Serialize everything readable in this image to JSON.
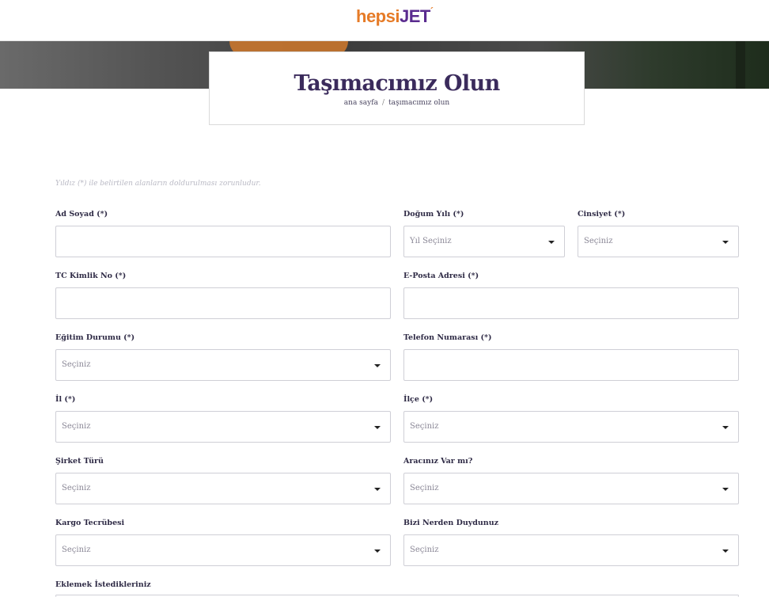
{
  "header": {
    "logo_hepsi": "hepsi",
    "logo_jet": "JET",
    "logo_mark": "´"
  },
  "hero": {
    "title": "Taşımacımız Olun",
    "breadcrumb": {
      "home": "ana sayfa",
      "separator": "/",
      "current": "taşımacımız olun"
    }
  },
  "form": {
    "notice": "Yıldız (*) ile belirtilen alanların doldurulması zorunludur.",
    "fields": {
      "ad_soyad": {
        "label": "Ad Soyad (*)",
        "value": ""
      },
      "dogum_yili": {
        "label": "Doğum Yılı (*)",
        "placeholder": "Yıl Seçiniz"
      },
      "cinsiyet": {
        "label": "Cinsiyet (*)",
        "placeholder": "Seçiniz"
      },
      "tc_kimlik": {
        "label": "TC Kimlik No (*)",
        "value": ""
      },
      "eposta": {
        "label": "E-Posta Adresi (*)",
        "value": ""
      },
      "egitim": {
        "label": "Eğitim Durumu (*)",
        "placeholder": "Seçiniz"
      },
      "telefon": {
        "label": "Telefon Numarası (*)",
        "value": ""
      },
      "il": {
        "label": "İl (*)",
        "placeholder": "Seçiniz"
      },
      "ilce": {
        "label": "İlçe (*)",
        "placeholder": "Seçiniz"
      },
      "sirket_turu": {
        "label": "Şirket Türü",
        "placeholder": "Seçiniz"
      },
      "araciniz": {
        "label": "Aracınız Var mı?",
        "placeholder": "Seçiniz"
      },
      "kargo_tecrubesi": {
        "label": "Kargo Tecrübesi",
        "placeholder": "Seçiniz"
      },
      "bizi_nerden": {
        "label": "Bizi Nerden Duydunuz",
        "placeholder": "Seçiniz"
      },
      "eklemek": {
        "label": "Eklemek İstedikleriniz"
      }
    }
  }
}
